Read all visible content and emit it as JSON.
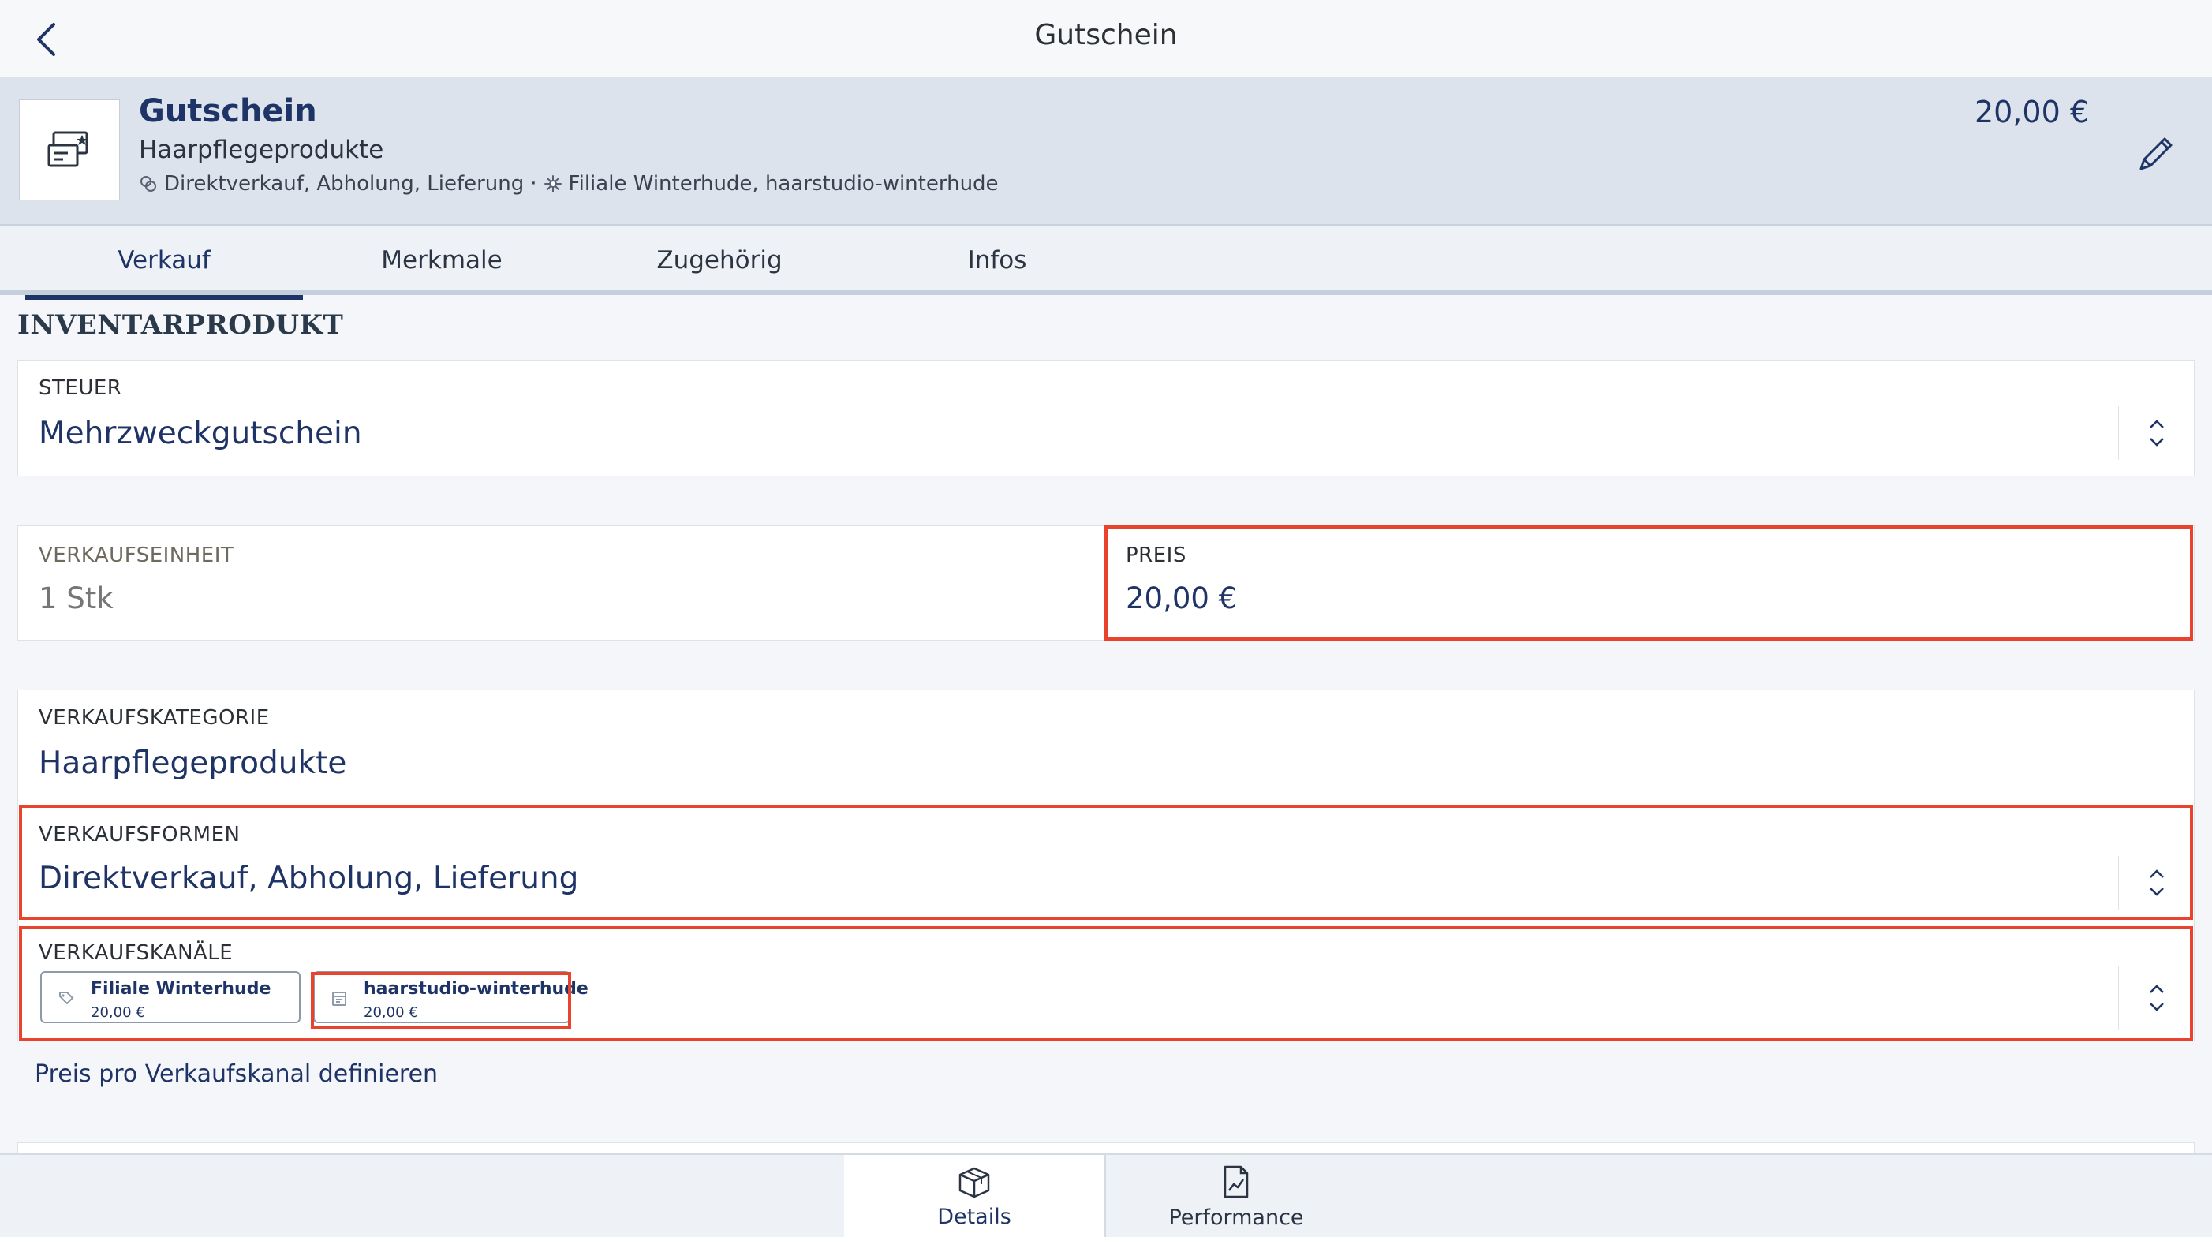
{
  "nav": {
    "title": "Gutschein"
  },
  "product": {
    "name": "Gutschein",
    "category": "Haarpflegeprodukte",
    "sales_forms": "Direktverkauf, Abholung, Lieferung",
    "separator": "·",
    "channels": "Filiale Winterhude, haarstudio-winterhude",
    "price": "20,00 €"
  },
  "tabs": [
    {
      "label": "Verkauf",
      "active": true
    },
    {
      "label": "Merkmale",
      "active": false
    },
    {
      "label": "Zugehörig",
      "active": false
    },
    {
      "label": "Infos",
      "active": false
    }
  ],
  "section": {
    "title": "INVENTARPRODUKT"
  },
  "fields": {
    "steuer": {
      "label": "STEUER",
      "value": "Mehrzweckgutschein"
    },
    "verkaufseinheit": {
      "label": "VERKAUFSEINHEIT",
      "value": "1 Stk"
    },
    "preis": {
      "label": "PREIS",
      "value": "20,00 €"
    },
    "verkaufskategorie": {
      "label": "VERKAUFSKATEGORIE",
      "value": "Haarpflegeprodukte"
    },
    "verkaufsformen": {
      "label": "VERKAUFSFORMEN",
      "value": "Direktverkauf, Abholung, Lieferung"
    },
    "verkaufskanaele": {
      "label": "VERKAUFSKANÄLE",
      "chips": [
        {
          "name": "Filiale Winterhude",
          "price": "20,00 €",
          "icon": "store-tag-icon"
        },
        {
          "name": "haarstudio-winterhude",
          "price": "20,00 €",
          "icon": "webshop-icon"
        }
      ]
    }
  },
  "link": {
    "label": "Preis pro Verkaufskanal definieren"
  },
  "bottom_tabs": [
    {
      "label": "Details",
      "icon": "box-icon",
      "active": true
    },
    {
      "label": "Performance",
      "icon": "chart-document-icon",
      "active": false
    }
  ],
  "colors": {
    "accent": "#1f3466",
    "highlight": "#e8432d",
    "header_bg": "#dde3ec"
  }
}
